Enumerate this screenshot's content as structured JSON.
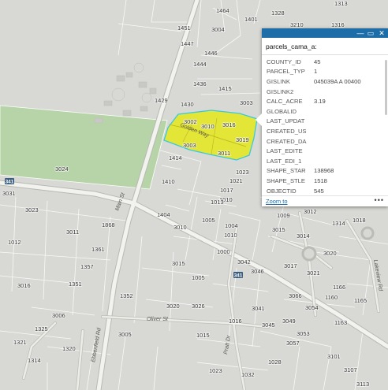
{
  "popup": {
    "title": "parcels_cama_a:",
    "zoom_link": "Zoom to",
    "more": "•••",
    "minimize": "—",
    "dock": "▭",
    "close": "✕",
    "fields": [
      {
        "key": "COUNTY_ID",
        "value": "45"
      },
      {
        "key": "PARCEL_TYP",
        "value": "1"
      },
      {
        "key": "GISLINK",
        "value": "045039A A 00400"
      },
      {
        "key": "GISLINK2",
        "value": ""
      },
      {
        "key": "CALC_ACRE",
        "value": "3.19"
      },
      {
        "key": "GLOBALID",
        "value": ""
      },
      {
        "key": "LAST_UPDAT",
        "value": ""
      },
      {
        "key": "CREATED_US",
        "value": ""
      },
      {
        "key": "CREATED_DA",
        "value": ""
      },
      {
        "key": "LAST_EDITE",
        "value": ""
      },
      {
        "key": "LAST_EDI_1",
        "value": ""
      },
      {
        "key": "SHAPE_STAR",
        "value": "138968"
      },
      {
        "key": "SHAPE_STLE",
        "value": "1518"
      },
      {
        "key": "OBJECTID",
        "value": "545"
      }
    ]
  },
  "map": {
    "colors": {
      "background": "#d8d8d4",
      "park": "#b7d3a8",
      "parcel_line": "#ffffff",
      "road": "#f2f2ee",
      "road_casing": "#b9b9b4",
      "highlight": "#e4e826",
      "highlight_outline": "#36c9e0"
    },
    "route_shield": "341",
    "streets": [
      "Golden Way",
      "Oliver St",
      "Main St",
      "Ebbenfield Rd",
      "Pratt Dr",
      "Lakeview Rd"
    ],
    "parcel_labels": [
      "1464",
      "1401",
      "1328",
      "1313",
      "3210",
      "1316",
      "1451",
      "3004",
      "1447",
      "1446",
      "1444",
      "1436",
      "1415",
      "1429",
      "1430",
      "3003",
      "3002",
      "3010",
      "3016",
      "3019",
      "3003",
      "3011",
      "1414",
      "1023",
      "1410",
      "1021",
      "1017",
      "1010",
      "1013",
      "1404",
      "3010",
      "1005",
      "1004",
      "3012",
      "1314",
      "1018",
      "1009",
      "3015",
      "1010",
      "3014",
      "3024",
      "3031",
      "3023",
      "1868",
      "3011",
      "1012",
      "1361",
      "1357",
      "3016",
      "1351",
      "1000",
      "3015",
      "3042",
      "3046",
      "3017",
      "3020",
      "3021",
      "1005",
      "1352",
      "3020",
      "3026",
      "3066",
      "1166",
      "3054",
      "1160",
      "1165",
      "1163",
      "3006",
      "3041",
      "1325",
      "1321",
      "1314",
      "1320",
      "3005",
      "1016",
      "3049",
      "3045",
      "1015",
      "3053",
      "3057",
      "3101",
      "1023",
      "1032",
      "1028",
      "3107",
      "3113"
    ]
  }
}
